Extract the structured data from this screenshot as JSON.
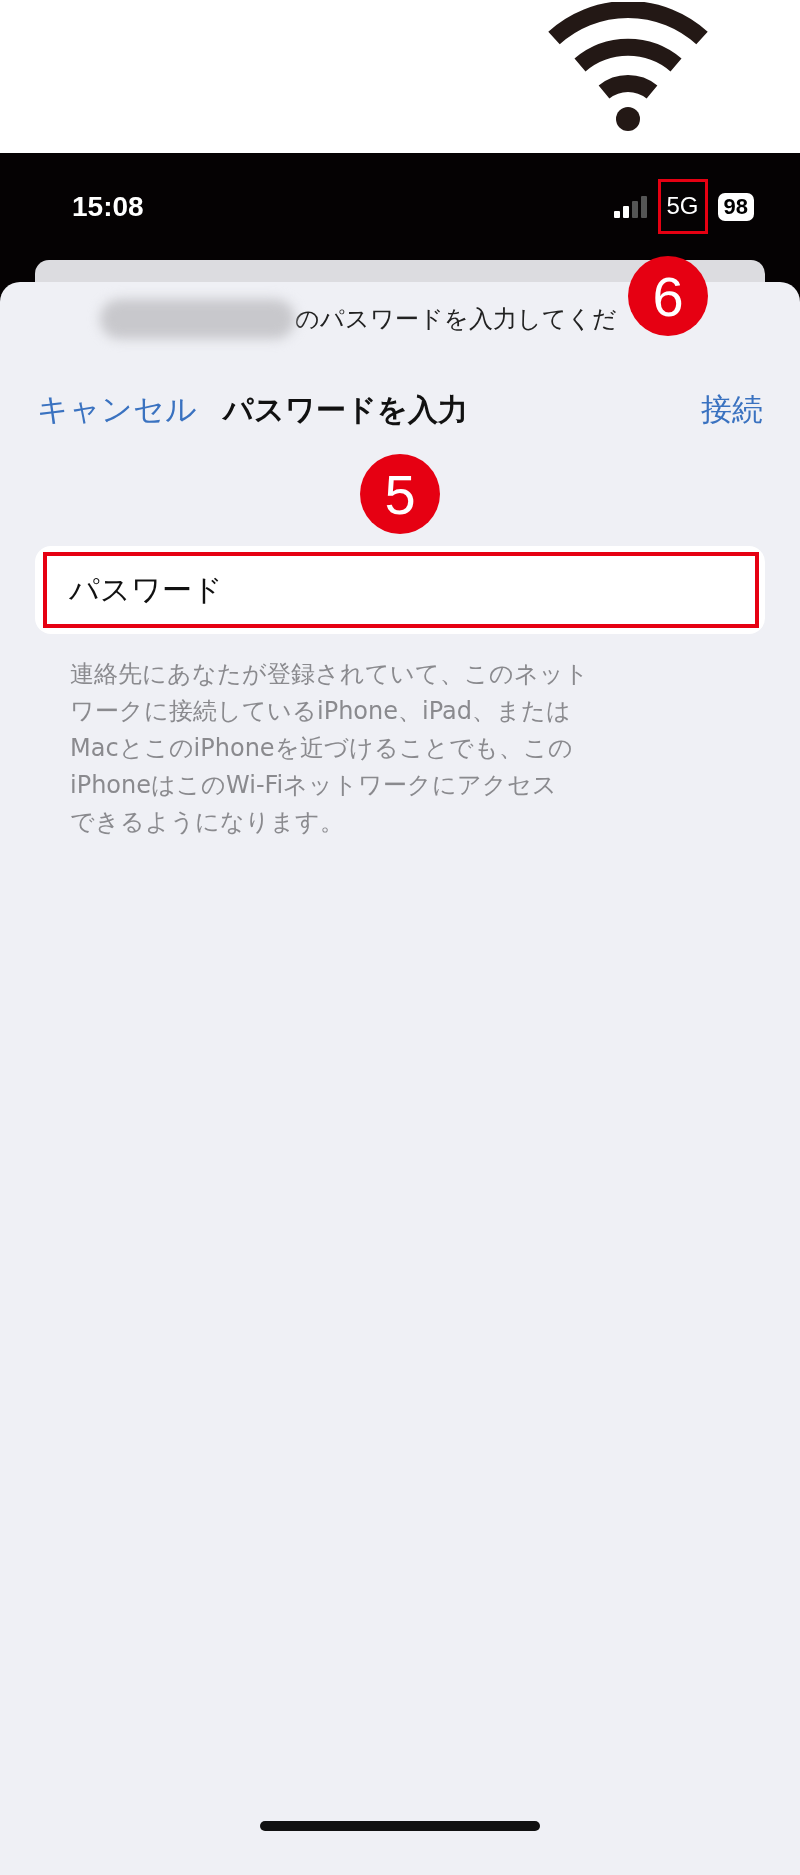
{
  "status_bar": {
    "time": "15:08",
    "network": "5G",
    "network_annotation": "6",
    "battery": "98"
  },
  "prompt": {
    "text": "のパスワードを入力してくだ"
  },
  "nav": {
    "cancel": "キャンセル",
    "title": "パスワードを入力",
    "connect": "接続"
  },
  "password_field": {
    "annotation": "5",
    "label": "パスワード"
  },
  "description": [
    "連絡先にあなたが登録されていて、このネット",
    "ワークに接続しているiPhone、iPad、または",
    "MacとこのiPhoneを近づけることでも、この",
    "iPhoneはこのWi-Fiネットワークにアクセス",
    "できるようになります。"
  ]
}
